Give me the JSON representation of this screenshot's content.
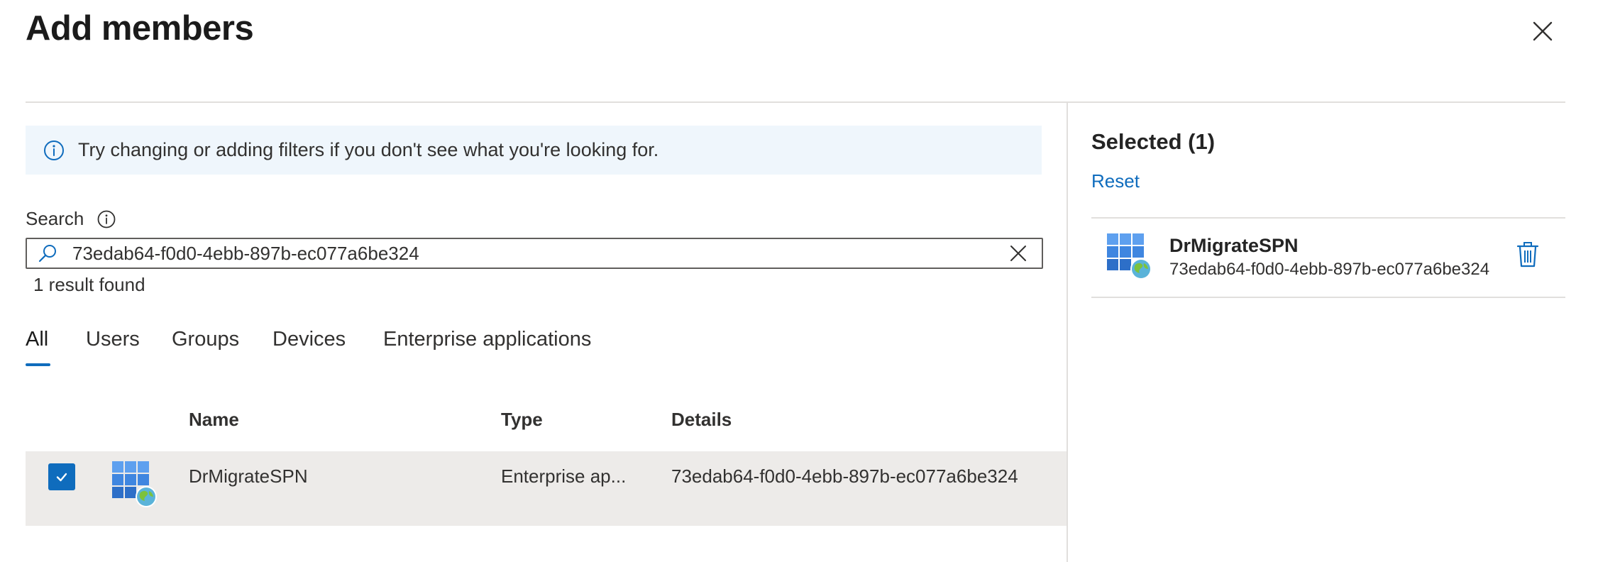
{
  "title": "Add members",
  "info_banner": {
    "text": "Try changing or adding filters if you don't see what you're looking for."
  },
  "search": {
    "label": "Search",
    "value": "73edab64-f0d0-4ebb-897b-ec077a6be324",
    "result_count": "1 result found"
  },
  "tabs": [
    {
      "label": "All",
      "active": true
    },
    {
      "label": "Users",
      "active": false
    },
    {
      "label": "Groups",
      "active": false
    },
    {
      "label": "Devices",
      "active": false
    },
    {
      "label": "Enterprise applications",
      "active": false
    }
  ],
  "table": {
    "columns": [
      "Name",
      "Type",
      "Details"
    ],
    "rows": [
      {
        "checked": true,
        "icon": "enterprise-app-icon",
        "name": "DrMigrateSPN",
        "type": "Enterprise ap...",
        "details": "73edab64-f0d0-4ebb-897b-ec077a6be324"
      }
    ]
  },
  "selected": {
    "title": "Selected (1)",
    "reset_label": "Reset",
    "items": [
      {
        "icon": "enterprise-app-icon",
        "name": "DrMigrateSPN",
        "id": "73edab64-f0d0-4ebb-897b-ec077a6be324"
      }
    ]
  },
  "colors": {
    "accent": "#0f6cbd",
    "banner_bg": "#eff6fc",
    "row_selected_bg": "#edebe9",
    "divider": "#e1dfdd"
  }
}
